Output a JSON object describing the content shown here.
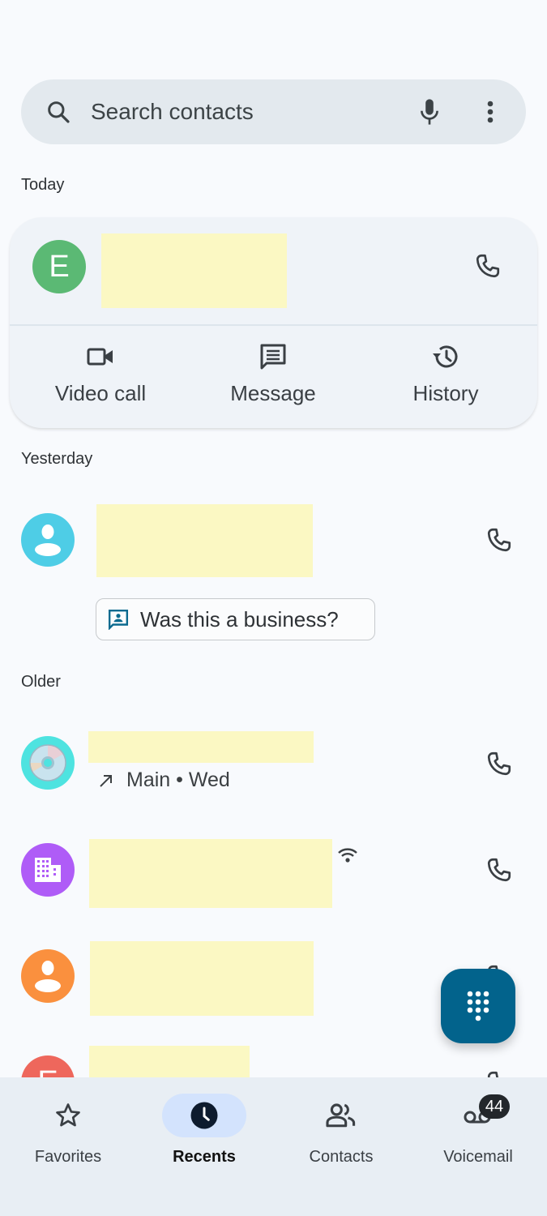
{
  "search": {
    "placeholder": "Search contacts",
    "icons": [
      "search-icon",
      "microphone-icon",
      "more-vert-icon"
    ]
  },
  "sections": {
    "today": "Today",
    "yesterday": "Yesterday",
    "older": "Older"
  },
  "expanded_call": {
    "avatar_letter": "E",
    "avatar_color": "#5bb974",
    "actions": [
      {
        "label": "Video call",
        "icon": "videocam-icon"
      },
      {
        "label": "Message",
        "icon": "message-icon"
      },
      {
        "label": "History",
        "icon": "history-icon"
      }
    ]
  },
  "yesterday_call": {
    "avatar_color": "#4ecde6",
    "chip_label": "Was this a business?"
  },
  "older_calls": [
    {
      "avatar_type": "cd-image",
      "avatar_color": "#4ee3e0",
      "subline": "Main • Wed",
      "direction_icon": "call-made-icon"
    },
    {
      "avatar_type": "business",
      "avatar_color": "#af5cf7",
      "extra_icon": "wifi-calling-icon"
    },
    {
      "avatar_type": "person",
      "avatar_color": "#fa903e"
    },
    {
      "avatar_type": "letter",
      "avatar_letter": "E",
      "avatar_color": "#ee675c"
    }
  ],
  "fab": {
    "icon": "dialpad-icon",
    "color": "#02638c"
  },
  "nav": {
    "items": [
      {
        "label": "Favorites",
        "icon": "star-icon",
        "active": false
      },
      {
        "label": "Recents",
        "icon": "clock-icon",
        "active": true
      },
      {
        "label": "Contacts",
        "icon": "people-icon",
        "active": false
      },
      {
        "label": "Voicemail",
        "icon": "voicemail-icon",
        "active": false
      }
    ],
    "voicemail_badge": "44"
  }
}
